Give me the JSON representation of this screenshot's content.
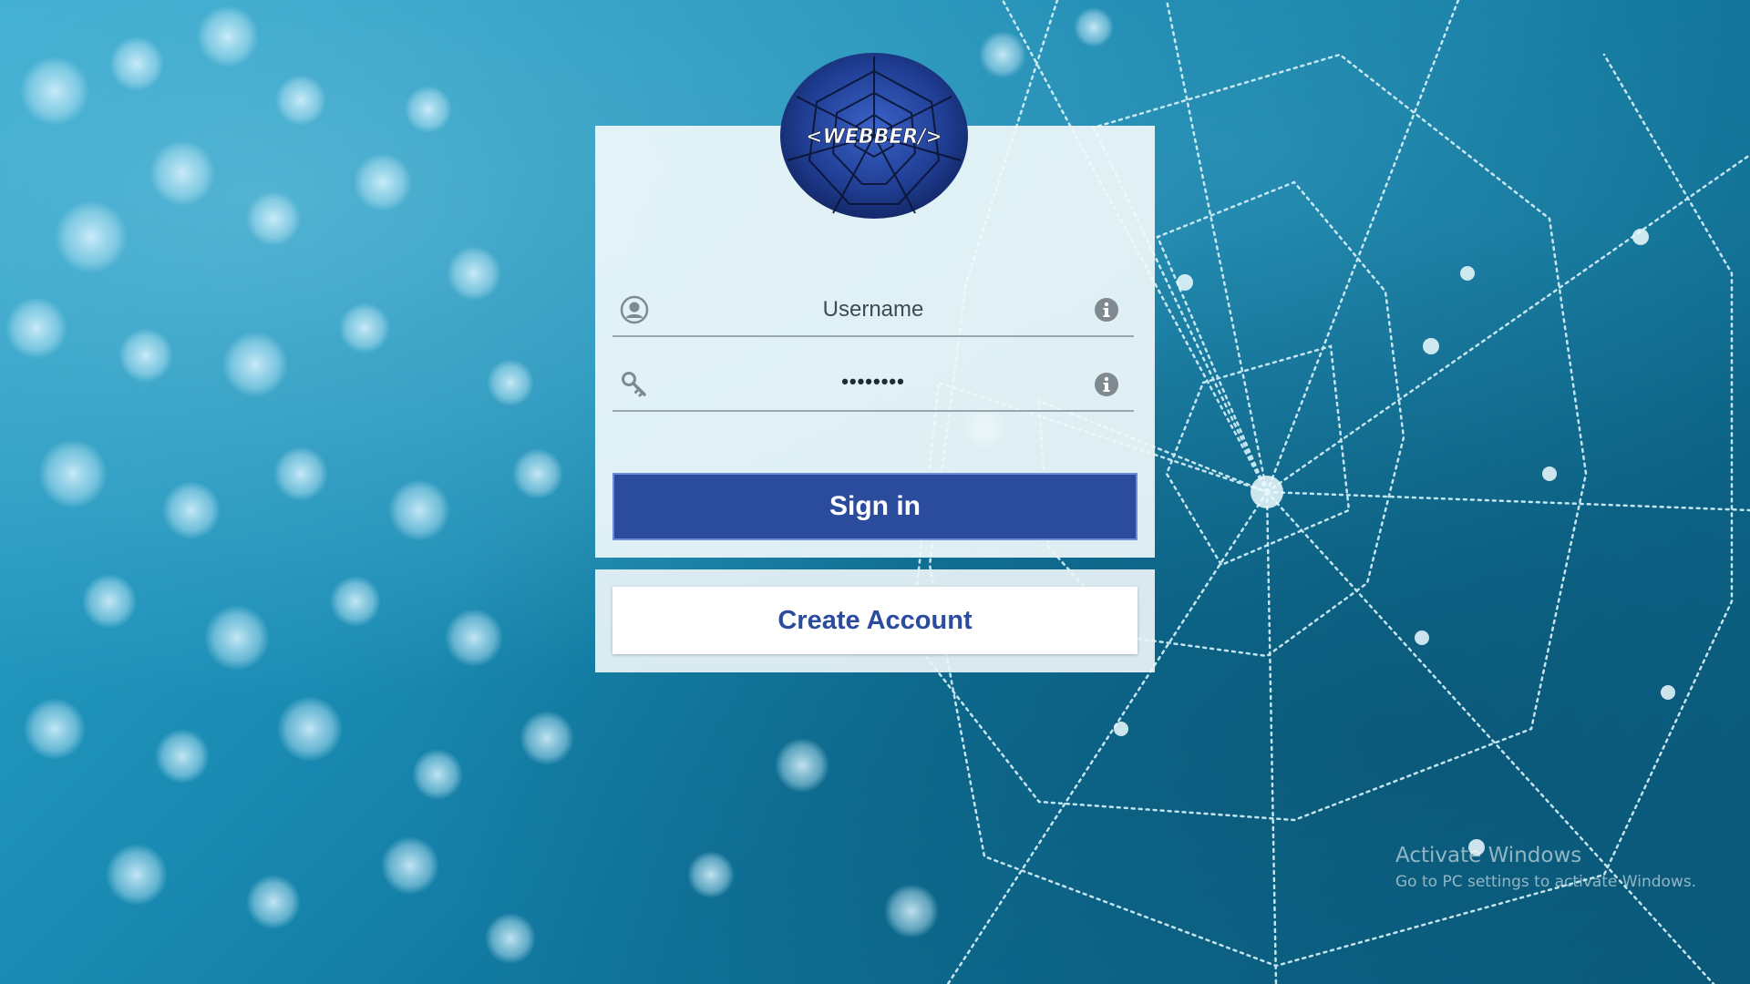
{
  "app": {
    "logo_text": "<WEBBER/>",
    "background": "spider-web-dew-photo"
  },
  "login": {
    "username_placeholder": "Username",
    "password_value": "••••••••",
    "username_icon": "user-circle-icon",
    "password_icon": "key-icon",
    "info_icon": "info-circle-icon",
    "signin_label": "Sign in",
    "create_label": "Create Account"
  },
  "watermark": {
    "title": "Activate Windows",
    "subtitle": "Go to PC settings to activate Windows."
  },
  "colors": {
    "primary": "#2b4c9c",
    "card_bg": "#f0f8fb",
    "bg_teal": "#1b8db5"
  }
}
